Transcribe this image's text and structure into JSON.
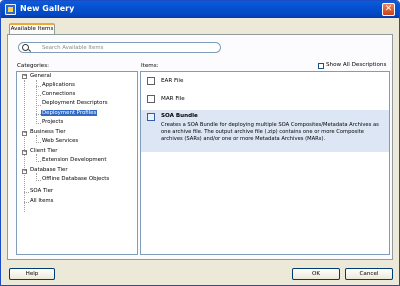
{
  "window": {
    "title": "New Gallery",
    "close_glyph": "✕"
  },
  "tab": {
    "label": "Available Items"
  },
  "search": {
    "placeholder": "Search Available Items"
  },
  "categories": {
    "label": "Categories:",
    "tree": [
      {
        "label": "General",
        "level": 0,
        "expanded": true
      },
      {
        "label": "Applications",
        "level": 1
      },
      {
        "label": "Connections",
        "level": 1
      },
      {
        "label": "Deployment Descriptors",
        "level": 1
      },
      {
        "label": "Deployment Profiles",
        "level": 1,
        "selected": true
      },
      {
        "label": "Projects",
        "level": 1
      },
      {
        "label": "Business Tier",
        "level": 0,
        "expanded": true
      },
      {
        "label": "Web Services",
        "level": 1
      },
      {
        "label": "Client Tier",
        "level": 0,
        "expanded": true
      },
      {
        "label": "Extension Development",
        "level": 1
      },
      {
        "label": "Database Tier",
        "level": 0,
        "expanded": true
      },
      {
        "label": "Offline Database Objects",
        "level": 1
      },
      {
        "label": "SOA Tier",
        "level": 0
      },
      {
        "label": "All Items",
        "level": 0
      }
    ]
  },
  "items": {
    "label": "Items:",
    "show_all_label": "Show All Descriptions",
    "list": [
      {
        "name": "EAR File"
      },
      {
        "name": "MAR File"
      },
      {
        "name": "SOA Bundle",
        "selected": true,
        "description": "Creates a SOA Bundle for deploying multiple SOA Composites/Metadata Archives as one archive file. The output archive file (.zip) contains one or more Composite archives (SARs) and/or one or more Metadata Archives (MARs)."
      }
    ]
  },
  "buttons": {
    "help": "Help",
    "ok": "OK",
    "cancel": "Cancel"
  },
  "toggle_glyph": "−"
}
